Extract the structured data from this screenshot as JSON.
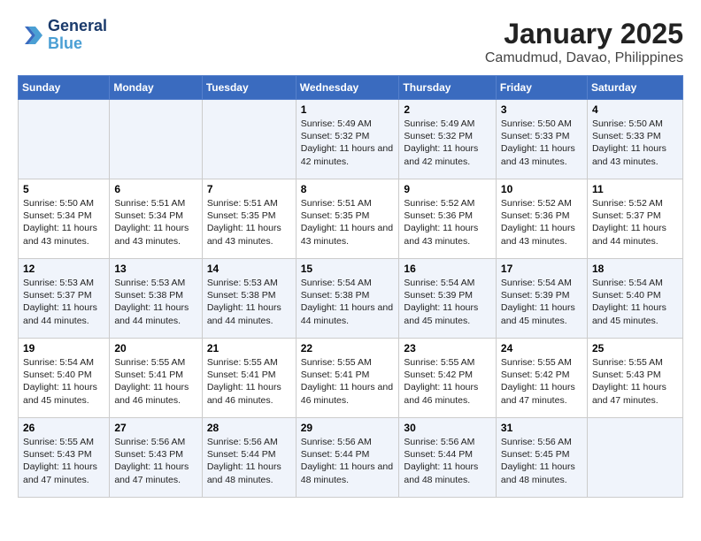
{
  "header": {
    "logo_line1": "General",
    "logo_line2": "Blue",
    "title": "January 2025",
    "subtitle": "Camudmud, Davao, Philippines"
  },
  "weekdays": [
    "Sunday",
    "Monday",
    "Tuesday",
    "Wednesday",
    "Thursday",
    "Friday",
    "Saturday"
  ],
  "weeks": [
    [
      {
        "day": "",
        "sunrise": "",
        "sunset": "",
        "daylight": ""
      },
      {
        "day": "",
        "sunrise": "",
        "sunset": "",
        "daylight": ""
      },
      {
        "day": "",
        "sunrise": "",
        "sunset": "",
        "daylight": ""
      },
      {
        "day": "1",
        "sunrise": "Sunrise: 5:49 AM",
        "sunset": "Sunset: 5:32 PM",
        "daylight": "Daylight: 11 hours and 42 minutes."
      },
      {
        "day": "2",
        "sunrise": "Sunrise: 5:49 AM",
        "sunset": "Sunset: 5:32 PM",
        "daylight": "Daylight: 11 hours and 42 minutes."
      },
      {
        "day": "3",
        "sunrise": "Sunrise: 5:50 AM",
        "sunset": "Sunset: 5:33 PM",
        "daylight": "Daylight: 11 hours and 43 minutes."
      },
      {
        "day": "4",
        "sunrise": "Sunrise: 5:50 AM",
        "sunset": "Sunset: 5:33 PM",
        "daylight": "Daylight: 11 hours and 43 minutes."
      }
    ],
    [
      {
        "day": "5",
        "sunrise": "Sunrise: 5:50 AM",
        "sunset": "Sunset: 5:34 PM",
        "daylight": "Daylight: 11 hours and 43 minutes."
      },
      {
        "day": "6",
        "sunrise": "Sunrise: 5:51 AM",
        "sunset": "Sunset: 5:34 PM",
        "daylight": "Daylight: 11 hours and 43 minutes."
      },
      {
        "day": "7",
        "sunrise": "Sunrise: 5:51 AM",
        "sunset": "Sunset: 5:35 PM",
        "daylight": "Daylight: 11 hours and 43 minutes."
      },
      {
        "day": "8",
        "sunrise": "Sunrise: 5:51 AM",
        "sunset": "Sunset: 5:35 PM",
        "daylight": "Daylight: 11 hours and 43 minutes."
      },
      {
        "day": "9",
        "sunrise": "Sunrise: 5:52 AM",
        "sunset": "Sunset: 5:36 PM",
        "daylight": "Daylight: 11 hours and 43 minutes."
      },
      {
        "day": "10",
        "sunrise": "Sunrise: 5:52 AM",
        "sunset": "Sunset: 5:36 PM",
        "daylight": "Daylight: 11 hours and 43 minutes."
      },
      {
        "day": "11",
        "sunrise": "Sunrise: 5:52 AM",
        "sunset": "Sunset: 5:37 PM",
        "daylight": "Daylight: 11 hours and 44 minutes."
      }
    ],
    [
      {
        "day": "12",
        "sunrise": "Sunrise: 5:53 AM",
        "sunset": "Sunset: 5:37 PM",
        "daylight": "Daylight: 11 hours and 44 minutes."
      },
      {
        "day": "13",
        "sunrise": "Sunrise: 5:53 AM",
        "sunset": "Sunset: 5:38 PM",
        "daylight": "Daylight: 11 hours and 44 minutes."
      },
      {
        "day": "14",
        "sunrise": "Sunrise: 5:53 AM",
        "sunset": "Sunset: 5:38 PM",
        "daylight": "Daylight: 11 hours and 44 minutes."
      },
      {
        "day": "15",
        "sunrise": "Sunrise: 5:54 AM",
        "sunset": "Sunset: 5:38 PM",
        "daylight": "Daylight: 11 hours and 44 minutes."
      },
      {
        "day": "16",
        "sunrise": "Sunrise: 5:54 AM",
        "sunset": "Sunset: 5:39 PM",
        "daylight": "Daylight: 11 hours and 45 minutes."
      },
      {
        "day": "17",
        "sunrise": "Sunrise: 5:54 AM",
        "sunset": "Sunset: 5:39 PM",
        "daylight": "Daylight: 11 hours and 45 minutes."
      },
      {
        "day": "18",
        "sunrise": "Sunrise: 5:54 AM",
        "sunset": "Sunset: 5:40 PM",
        "daylight": "Daylight: 11 hours and 45 minutes."
      }
    ],
    [
      {
        "day": "19",
        "sunrise": "Sunrise: 5:54 AM",
        "sunset": "Sunset: 5:40 PM",
        "daylight": "Daylight: 11 hours and 45 minutes."
      },
      {
        "day": "20",
        "sunrise": "Sunrise: 5:55 AM",
        "sunset": "Sunset: 5:41 PM",
        "daylight": "Daylight: 11 hours and 46 minutes."
      },
      {
        "day": "21",
        "sunrise": "Sunrise: 5:55 AM",
        "sunset": "Sunset: 5:41 PM",
        "daylight": "Daylight: 11 hours and 46 minutes."
      },
      {
        "day": "22",
        "sunrise": "Sunrise: 5:55 AM",
        "sunset": "Sunset: 5:41 PM",
        "daylight": "Daylight: 11 hours and 46 minutes."
      },
      {
        "day": "23",
        "sunrise": "Sunrise: 5:55 AM",
        "sunset": "Sunset: 5:42 PM",
        "daylight": "Daylight: 11 hours and 46 minutes."
      },
      {
        "day": "24",
        "sunrise": "Sunrise: 5:55 AM",
        "sunset": "Sunset: 5:42 PM",
        "daylight": "Daylight: 11 hours and 47 minutes."
      },
      {
        "day": "25",
        "sunrise": "Sunrise: 5:55 AM",
        "sunset": "Sunset: 5:43 PM",
        "daylight": "Daylight: 11 hours and 47 minutes."
      }
    ],
    [
      {
        "day": "26",
        "sunrise": "Sunrise: 5:55 AM",
        "sunset": "Sunset: 5:43 PM",
        "daylight": "Daylight: 11 hours and 47 minutes."
      },
      {
        "day": "27",
        "sunrise": "Sunrise: 5:56 AM",
        "sunset": "Sunset: 5:43 PM",
        "daylight": "Daylight: 11 hours and 47 minutes."
      },
      {
        "day": "28",
        "sunrise": "Sunrise: 5:56 AM",
        "sunset": "Sunset: 5:44 PM",
        "daylight": "Daylight: 11 hours and 48 minutes."
      },
      {
        "day": "29",
        "sunrise": "Sunrise: 5:56 AM",
        "sunset": "Sunset: 5:44 PM",
        "daylight": "Daylight: 11 hours and 48 minutes."
      },
      {
        "day": "30",
        "sunrise": "Sunrise: 5:56 AM",
        "sunset": "Sunset: 5:44 PM",
        "daylight": "Daylight: 11 hours and 48 minutes."
      },
      {
        "day": "31",
        "sunrise": "Sunrise: 5:56 AM",
        "sunset": "Sunset: 5:45 PM",
        "daylight": "Daylight: 11 hours and 48 minutes."
      },
      {
        "day": "",
        "sunrise": "",
        "sunset": "",
        "daylight": ""
      }
    ]
  ]
}
